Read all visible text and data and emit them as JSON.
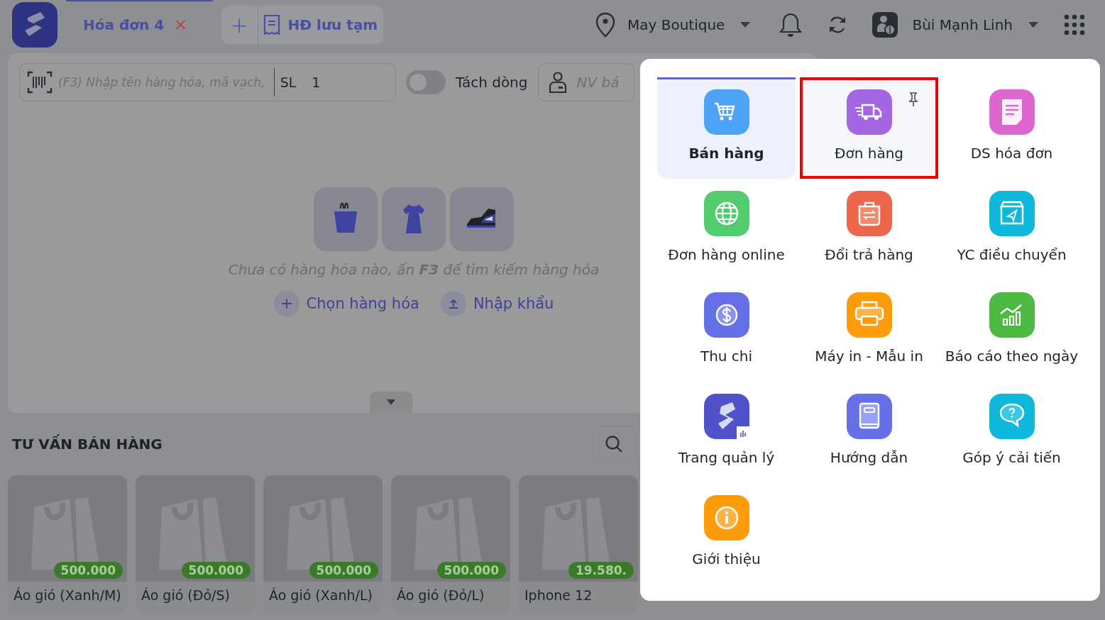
{
  "header": {
    "tabs": [
      {
        "label": "Hóa đơn 4",
        "selected": true
      }
    ],
    "close_tab": "✕",
    "add_tab": "+",
    "saved_invoices": "HĐ lưu tạm",
    "store": "May Boutique",
    "user": "Bùi Mạnh Linh"
  },
  "toolbar": {
    "search": {
      "placeholder": "(F3) Nhập tên hàng hóa, mã vạch,"
    },
    "quantity": {
      "label": "SL",
      "value": "1"
    },
    "split_lines": {
      "label": "Tách dòng",
      "on": false
    },
    "staff": {
      "placeholder": "NV bá"
    }
  },
  "empty_state": {
    "message": "Chưa có hàng hóa nào, ấn **F3** để tìm kiếm hàng hóa",
    "actions": [
      "Chọn hàng hóa",
      "Nhập khẩu"
    ]
  },
  "advice": {
    "title": "TƯ VẤN BÁN HÀNG",
    "products": [
      {
        "name": "Áo gió (Xanh/M)",
        "price": "500.000"
      },
      {
        "name": "Áo gió (Đỏ/S)",
        "price": "500.000"
      },
      {
        "name": "Áo gió (Xanh/L)",
        "price": "500.000"
      },
      {
        "name": "Áo gió (Đỏ/L)",
        "price": "500.000"
      },
      {
        "name": "Iphone 12",
        "price": "19.580."
      }
    ]
  },
  "menu": {
    "items": [
      {
        "label": "Bán hàng",
        "selected": true,
        "highlighted": false,
        "color": "#4da3f7"
      },
      {
        "label": "Đơn hàng",
        "selected": false,
        "highlighted": true,
        "color": "#a566e3"
      },
      {
        "label": "DS hóa đơn",
        "selected": false,
        "highlighted": false,
        "color": "#de66cf"
      },
      {
        "label": "Đơn hàng online",
        "selected": false,
        "highlighted": false,
        "color": "#52cc6e"
      },
      {
        "label": "Đổi trả hàng",
        "selected": false,
        "highlighted": false,
        "color": "#ec6749"
      },
      {
        "label": "YC điều chuyển",
        "selected": false,
        "highlighted": false,
        "color": "#0db8dc"
      },
      {
        "label": "Thu chi",
        "selected": false,
        "highlighted": false,
        "color": "#6670e6"
      },
      {
        "label": "Máy in - Mẫu in",
        "selected": false,
        "highlighted": false,
        "color": "#ff9c0a"
      },
      {
        "label": "Báo cáo theo ngày",
        "selected": false,
        "highlighted": false,
        "color": "#4db842"
      },
      {
        "label": "Trang quản lý",
        "selected": false,
        "highlighted": false,
        "color": "#4f52c9"
      },
      {
        "label": "Hướng dẫn",
        "selected": false,
        "highlighted": false,
        "color": "#6670e6"
      },
      {
        "label": "Góp ý cải tiến",
        "selected": false,
        "highlighted": false,
        "color": "#0db8dc"
      },
      {
        "label": "Giới thiệu",
        "selected": false,
        "highlighted": false,
        "color": "#ff9c0a"
      }
    ]
  }
}
